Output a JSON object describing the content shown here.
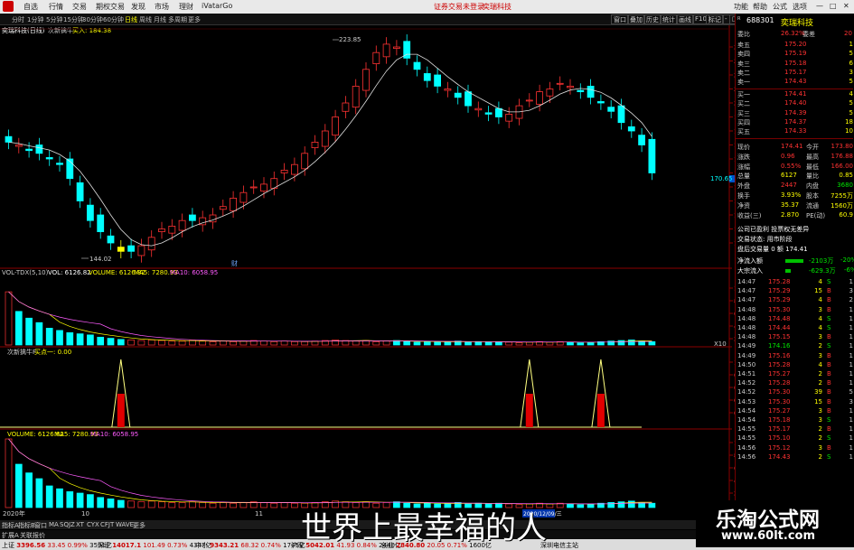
{
  "menu": {
    "items": [
      "自选",
      "行情",
      "交易",
      "期权交易",
      "发现",
      "市场",
      "理财",
      "iVatarGo"
    ],
    "center": [
      "证券交易未登录",
      "奕瑞科技"
    ],
    "right": [
      "功能",
      "帮助",
      "公式",
      "选项"
    ]
  },
  "toolbar": {
    "periods": [
      "分时",
      "1分钟",
      "5分钟",
      "15分钟",
      "30分钟",
      "60分钟",
      "日线",
      "周线",
      "月线",
      "多周期",
      "更多"
    ],
    "right_buttons": [
      "窗口",
      "叠加",
      "历史",
      "统计",
      "画线",
      "F10",
      "标记",
      "-",
      "□",
      "返回"
    ]
  },
  "chart": {
    "stock_title": "奕瑞科技(日线)",
    "indicator": "次新擒牛",
    "buy_label": "买入: 184.38",
    "high_label": "223.85",
    "low_label": "144.02",
    "current_price": "170.65",
    "y_ticks": [
      "220.0",
      "215.0",
      "210.0",
      "205.0",
      "200.0",
      "195.0",
      "190.0",
      "185.0",
      "180.0",
      "175.0",
      "170.0",
      "165.0",
      "160.0",
      "155.0",
      "150.0"
    ],
    "marker": "财",
    "vol_title": "VOL-TDX(5,10)",
    "vol_values": [
      "VOL: 6126.82",
      "VOLUME: 6126.82",
      "MA5: 7280.93",
      "MA10: 6058.95"
    ],
    "vol_ticks": [
      "10000",
      "8000",
      "6000",
      "4000",
      "2000"
    ],
    "vol_unit": "X10",
    "ind_title": "次新擒牛F",
    "ind_value": "买点一: 0.00",
    "ind_ticks": [
      "1.00",
      "0.80",
      "0.60",
      "0.40",
      "0.20"
    ],
    "vol2_values": [
      "VOLUME: 6126.82",
      "MA5: 7280.93",
      "MA10: 6058.95"
    ],
    "vol2_ticks": [
      "10000",
      "8000",
      "6000",
      "4000",
      "2000"
    ],
    "date_labels": [
      "2020年",
      "10",
      "2020/12/09/三",
      "11"
    ]
  },
  "chart_data": {
    "type": "table",
    "title": "奕瑞科技(日线)",
    "candles_note": "daily candlestick",
    "price_range": [
      144.02,
      223.85
    ],
    "current": 170.65,
    "signals_x": [
      "bar 11",
      "bar 52",
      "bar 61"
    ],
    "signal_values": [
      1,
      1,
      1
    ]
  },
  "panel": {
    "code": "688301",
    "name": "奕瑞科技",
    "weibi_label": "委比",
    "weibi": "26.32%",
    "weicha_label": "委差",
    "weicha": "20",
    "asks": [
      {
        "label": "卖五",
        "price": "175.20",
        "vol": "1"
      },
      {
        "label": "卖四",
        "price": "175.19",
        "vol": "5"
      },
      {
        "label": "卖三",
        "price": "175.18",
        "vol": "6"
      },
      {
        "label": "卖二",
        "price": "175.17",
        "vol": "3"
      },
      {
        "label": "卖一",
        "price": "174.43",
        "vol": "5"
      }
    ],
    "bids": [
      {
        "label": "买一",
        "price": "174.41",
        "vol": "4"
      },
      {
        "label": "买二",
        "price": "174.40",
        "vol": "5"
      },
      {
        "label": "买三",
        "price": "174.39",
        "vol": "5"
      },
      {
        "label": "买四",
        "price": "174.37",
        "vol": "18"
      },
      {
        "label": "买五",
        "price": "174.33",
        "vol": "10"
      }
    ],
    "stats": [
      {
        "l1": "现价",
        "v1": "174.41",
        "l2": "今开",
        "v2": "173.80"
      },
      {
        "l1": "涨跌",
        "v1": "0.96",
        "l2": "最高",
        "v2": "176.88"
      },
      {
        "l1": "涨幅",
        "v1": "0.55%",
        "l2": "最低",
        "v2": "166.00"
      },
      {
        "l1": "总量",
        "v1": "6127",
        "l2": "量比",
        "v2": "0.85"
      },
      {
        "l1": "外盘",
        "v1": "2447",
        "l2": "内盘",
        "v2": "3680"
      },
      {
        "l1": "换手",
        "v1": "3.93%",
        "l2": "股本",
        "v2": "7255万"
      },
      {
        "l1": "净资",
        "v1": "35.37",
        "l2": "流通",
        "v2": "1560万"
      },
      {
        "l1": "收益(三)",
        "v1": "2.870",
        "l2": "PE(动)",
        "v2": "60.9"
      }
    ],
    "notes": [
      "公司已盈利 投票权无差异",
      "交易状态: 用市阶段",
      "盘后交易量 0 额 174.41"
    ],
    "flows": [
      {
        "label": "净流入额",
        "value": "-2103万",
        "pct": "-20%"
      },
      {
        "label": "大宗流入",
        "value": "-629.3万",
        "pct": "-6%"
      }
    ],
    "ticks": [
      {
        "t": "14:47",
        "p": "175.28",
        "v": "4",
        "d": "S",
        "n": "1"
      },
      {
        "t": "14:47",
        "p": "175.29",
        "v": "15",
        "d": "B",
        "n": "3"
      },
      {
        "t": "14:47",
        "p": "175.29",
        "v": "4",
        "d": "B",
        "n": "2"
      },
      {
        "t": "14:48",
        "p": "175.30",
        "v": "3",
        "d": "B",
        "n": "1"
      },
      {
        "t": "14:48",
        "p": "174.48",
        "v": "4",
        "d": "S",
        "n": "1"
      },
      {
        "t": "14:48",
        "p": "174.44",
        "v": "4",
        "d": "S",
        "n": "1"
      },
      {
        "t": "14:48",
        "p": "175.15",
        "v": "3",
        "d": "B",
        "n": "1"
      },
      {
        "t": "14:49",
        "p": "174.16",
        "v": "2",
        "d": "S",
        "n": "1"
      },
      {
        "t": "14:49",
        "p": "175.16",
        "v": "3",
        "d": "B",
        "n": "1"
      },
      {
        "t": "14:50",
        "p": "175.28",
        "v": "4",
        "d": "B",
        "n": "1"
      },
      {
        "t": "14:51",
        "p": "175.27",
        "v": "2",
        "d": "B",
        "n": "1"
      },
      {
        "t": "14:52",
        "p": "175.28",
        "v": "2",
        "d": "B",
        "n": "1"
      },
      {
        "t": "14:52",
        "p": "175.30",
        "v": "39",
        "d": "B",
        "n": "5"
      },
      {
        "t": "14:53",
        "p": "175.30",
        "v": "15",
        "d": "B",
        "n": "3"
      },
      {
        "t": "14:54",
        "p": "175.27",
        "v": "3",
        "d": "B",
        "n": "1"
      },
      {
        "t": "14:54",
        "p": "175.18",
        "v": "3",
        "d": "S",
        "n": "1"
      },
      {
        "t": "14:55",
        "p": "175.17",
        "v": "2",
        "d": "B",
        "n": "1"
      },
      {
        "t": "14:55",
        "p": "175.10",
        "v": "2",
        "d": "S",
        "n": "1"
      },
      {
        "t": "14:56",
        "p": "175.12",
        "v": "3",
        "d": "B",
        "n": "1"
      },
      {
        "t": "14:56",
        "p": "174.43",
        "v": "2",
        "d": "S",
        "n": "1"
      }
    ]
  },
  "bottom_tabs": [
    "指标A",
    "指标B",
    "窗口",
    "MA",
    "SQJZ",
    "XT",
    "CYX",
    "CFJT",
    "WAVE",
    "更多"
  ],
  "bottom_left": [
    "扩展A",
    "关联报价"
  ],
  "status": {
    "items": [
      {
        "name": "上证",
        "val": "3396.56",
        "chg": "33.45",
        "pct": "0.99%",
        "amt": "3591亿"
      },
      {
        "name": "深证",
        "val": "14017.1",
        "chg": "101.49",
        "pct": "0.73%",
        "amt": "4347亿"
      },
      {
        "name": "中小",
        "val": "9343.21",
        "chg": "68.32",
        "pct": "0.74%",
        "amt": "1745亿"
      },
      {
        "name": "沪深",
        "val": "5042.01",
        "chg": "41.93",
        "pct": "0.84%",
        "amt": "2440亿"
      },
      {
        "name": "创业",
        "val": "2840.80",
        "chg": "20.05",
        "pct": "0.71%",
        "amt": "1600亿"
      }
    ],
    "right": "深圳电信主站"
  },
  "caption": "世界上最幸福的人",
  "brand": {
    "title": "乐淘公式网",
    "url": "www.60lt.com"
  }
}
